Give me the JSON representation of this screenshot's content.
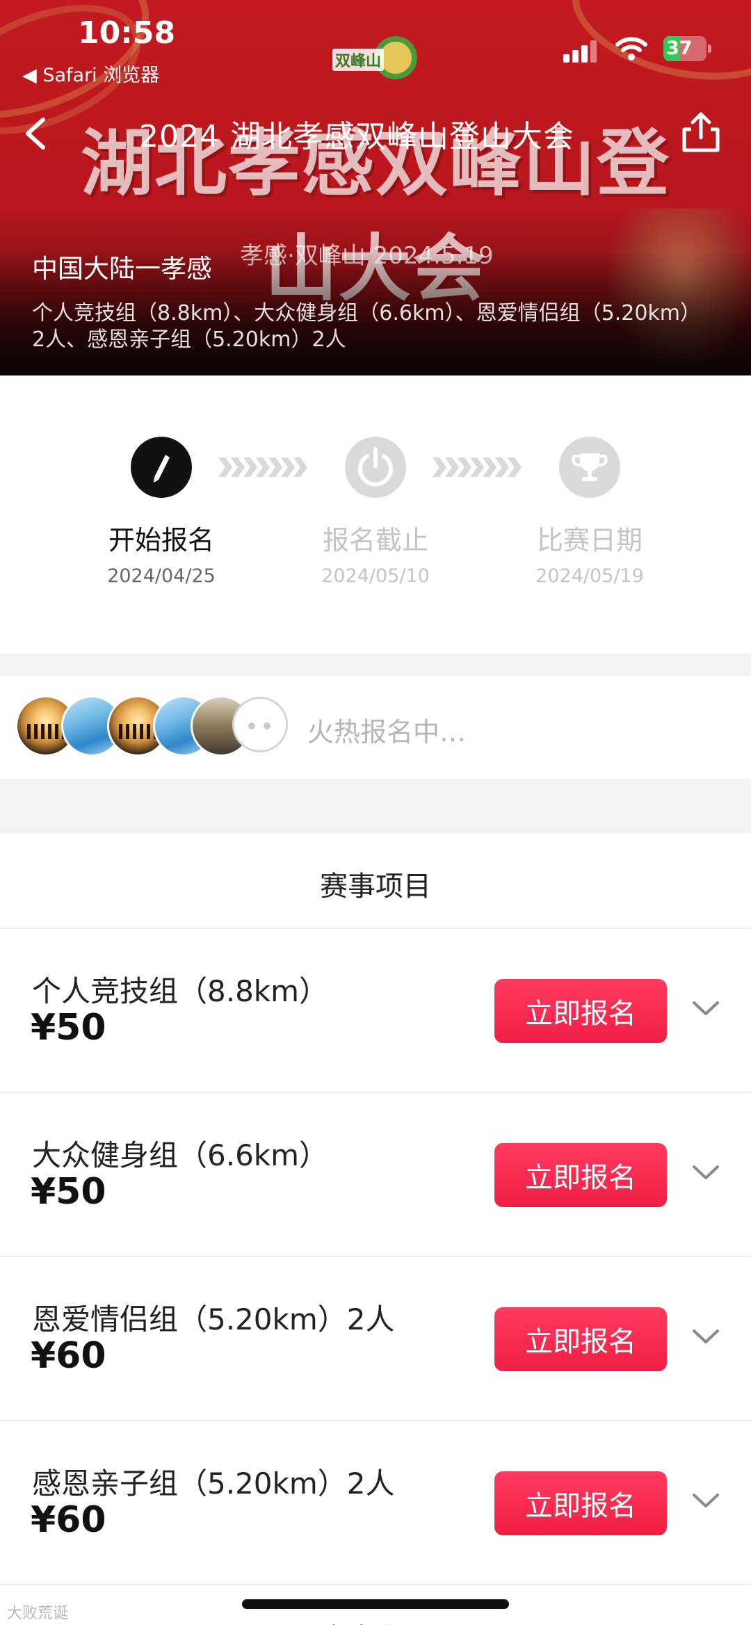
{
  "status_bar": {
    "time": "10:58",
    "back_app": "◀ Safari 浏览器",
    "battery": "37",
    "battery_level": 0.37
  },
  "banner": {
    "logo_text": "双峰山",
    "headline": "湖北孝感双峰山登山大会",
    "sub_line": "孝感·双峰山   2024.5.19"
  },
  "nav": {
    "title": "2024 湖北孝感双峰山登山大会"
  },
  "event_info": {
    "location": "中国大陆一孝感",
    "groups": "个人竞技组（8.8km）、大众健身组（6.6km）、恩爱情侣组（5.20km）2人、感恩亲子组（5.20km）2人"
  },
  "timeline": {
    "steps": [
      {
        "label": "开始报名",
        "date": "2024/04/25",
        "icon": "pen-icon",
        "state": "active"
      },
      {
        "label": "报名截止",
        "date": "2024/05/10",
        "icon": "power-icon",
        "state": "inactive"
      },
      {
        "label": "比赛日期",
        "date": "2024/05/19",
        "icon": "trophy-icon",
        "state": "inactive"
      }
    ]
  },
  "participants": {
    "status_text": "火热报名中…",
    "avatars": [
      "sunset-group-photo",
      "sea-wave-photo",
      "sunset-group-photo",
      "sea-wave-photo",
      "beach-couple-photo"
    ]
  },
  "events": {
    "section_title": "赛事项目",
    "signup_label": "立即报名",
    "items": [
      {
        "name": "个人竞技组（8.8km）",
        "price": "¥50"
      },
      {
        "name": "大众健身组（6.6km）",
        "price": "¥50"
      },
      {
        "name": "恩爱情侣组（5.20km）2人",
        "price": "¥60"
      },
      {
        "name": "感恩亲子组（5.20km）2人",
        "price": "¥60"
      }
    ]
  },
  "footer": {
    "next_section_peek": "赛事介绍",
    "watermark": "大败荒诞"
  },
  "colors": {
    "banner_red": "#c21a20",
    "signup_button": "#f01e45",
    "active_step": "#111111",
    "inactive_step": "#dadada"
  }
}
